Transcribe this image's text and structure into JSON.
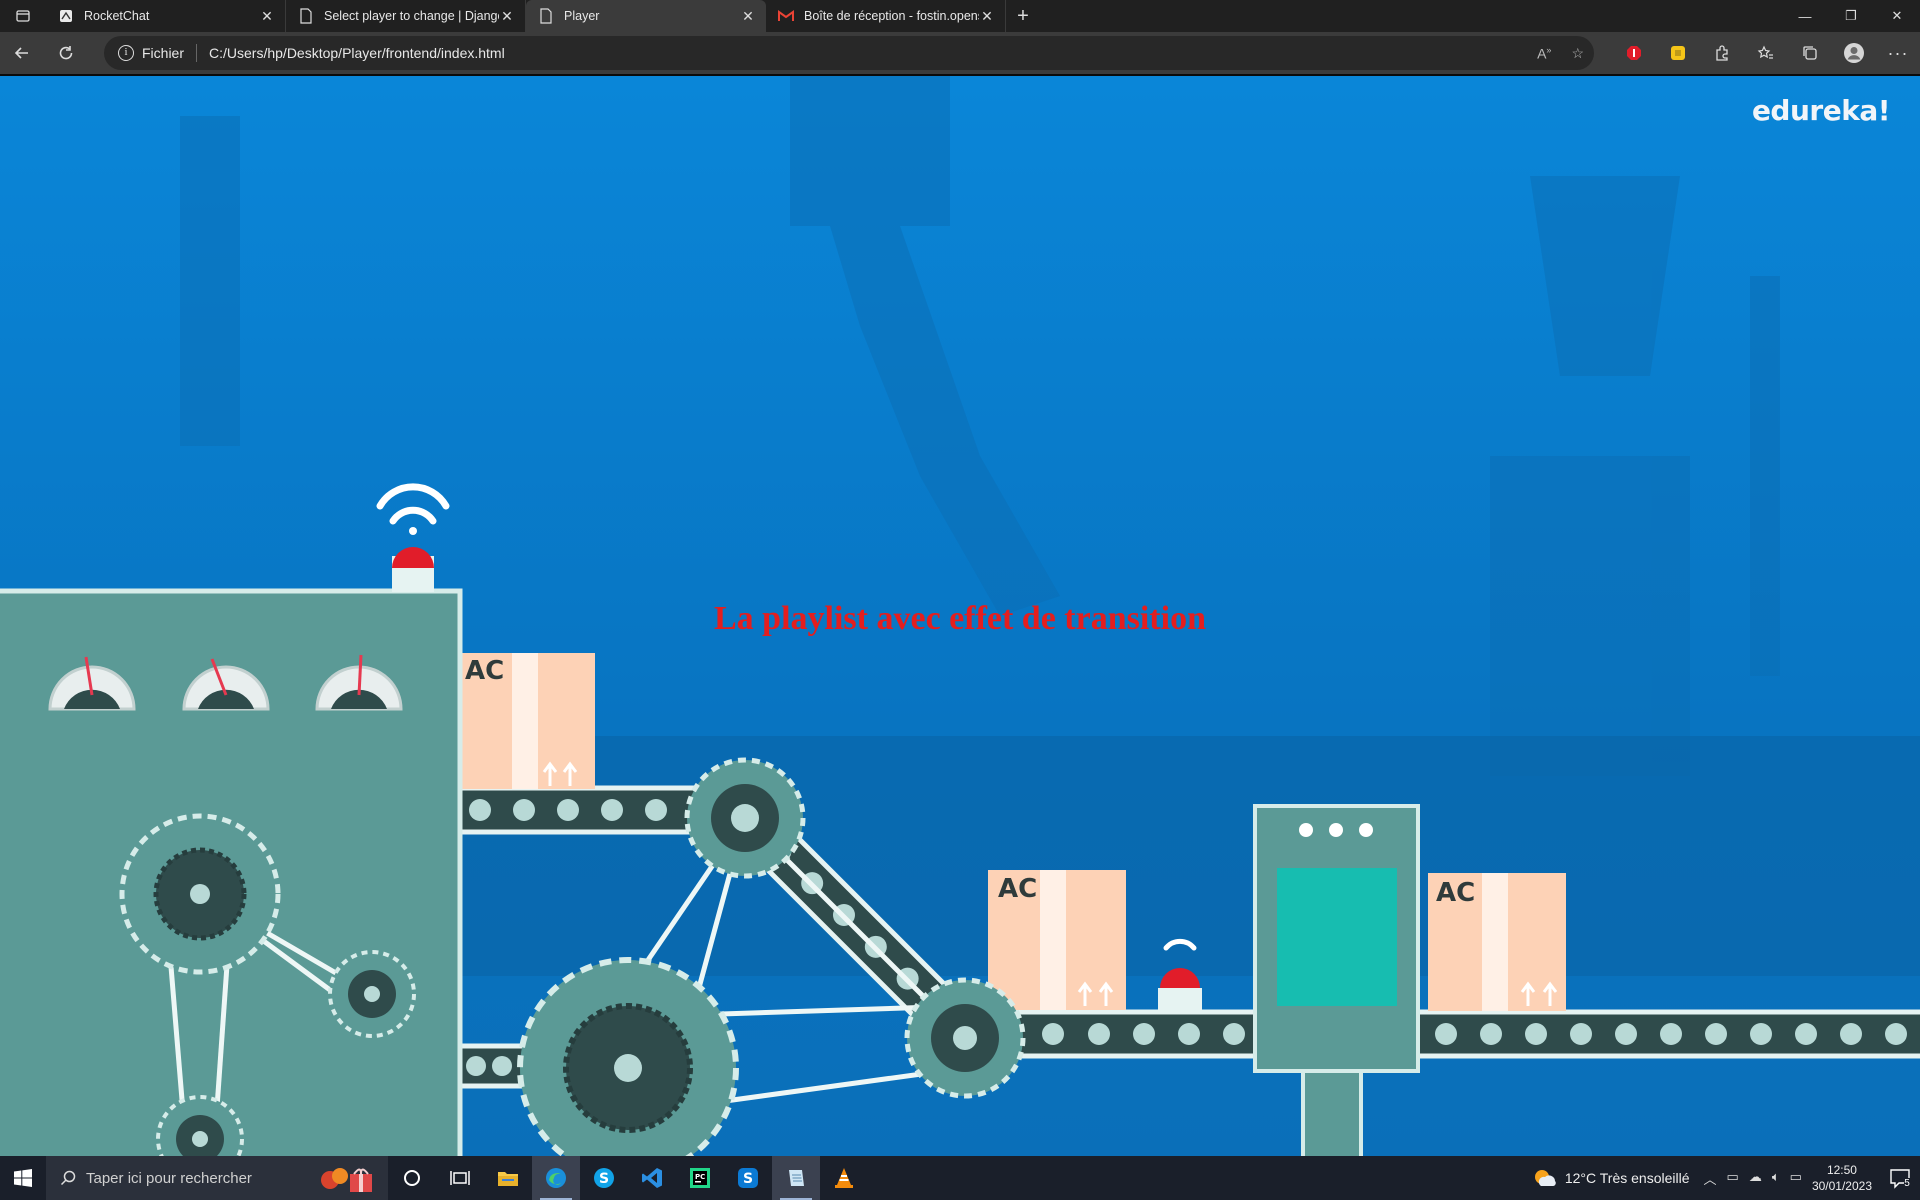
{
  "browser": {
    "tabs": [
      {
        "title": "RocketChat",
        "icon": "rocketchat-icon",
        "active": false
      },
      {
        "title": "Select player to change | Django",
        "icon": "page-icon",
        "active": false
      },
      {
        "title": "Player",
        "icon": "page-icon",
        "active": true
      },
      {
        "title": "Boîte de réception - fostin.opens",
        "icon": "gmail-icon",
        "active": false
      }
    ],
    "address": {
      "scheme_label": "Fichier",
      "url": "C:/Users/hp/Desktop/Player/frontend/index.html"
    }
  },
  "page": {
    "heading": "La playlist avec effet de transition",
    "video_watermark": "edureka!",
    "box_labels": [
      "AC",
      "AC",
      "AC"
    ]
  },
  "taskbar": {
    "search_placeholder": "Taper ici pour rechercher",
    "pinned": [
      "cortana-icon",
      "task-view-icon",
      "file-explorer-icon",
      "edge-icon",
      "skype-icon",
      "vscode-icon",
      "pycharm-icon",
      "skype-icon",
      "notepad-icon",
      "vlc-icon"
    ],
    "weather": "12°C  Très ensoleillé",
    "time": "12:50",
    "date": "30/01/2023",
    "notifications": "5"
  },
  "colors": {
    "video_blue": "#0a7fd0",
    "machine_teal": "#5b9a96",
    "gear_dark": "#2f4b4b",
    "heading_red": "#e41e1e"
  }
}
